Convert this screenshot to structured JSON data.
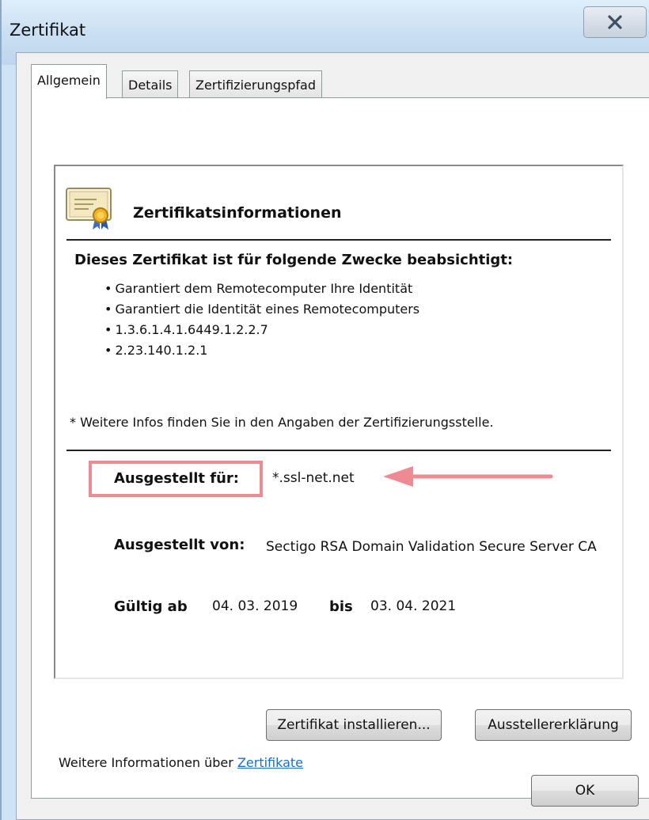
{
  "window": {
    "title": "Zertifikat"
  },
  "tabs": [
    {
      "label": "Allgemein"
    },
    {
      "label": "Details"
    },
    {
      "label": "Zertifizierungspfad"
    }
  ],
  "info": {
    "header": "Zertifikatsinformationen",
    "purpose_heading": "Dieses Zertifikat ist für folgende Zwecke beabsichtigt:",
    "purposes": [
      "Garantiert dem Remotecomputer Ihre Identität",
      "Garantiert die Identität eines Remotecomputers",
      "1.3.6.1.4.1.6449.1.2.2.7",
      "2.23.140.1.2.1"
    ],
    "note": "* Weitere Infos finden Sie in den Angaben der Zertifizierungsstelle.",
    "issued_to_label": "Ausgestellt für:",
    "issued_to_value": "*.ssl-net.net",
    "issued_by_label": "Ausgestellt von:",
    "issued_by_value": "Sectigo RSA Domain Validation Secure Server CA",
    "valid_from_label": "Gültig ab",
    "valid_from_value": "04. 03. 2019",
    "valid_to_label": "bis",
    "valid_to_value": "03. 04. 2021"
  },
  "buttons": {
    "install": "Zertifikat installieren...",
    "issuer_statement": "Ausstellererklärung",
    "ok": "OK"
  },
  "footer": {
    "text": "Weitere Informationen über ",
    "link": "Zertifikate"
  },
  "colors": {
    "highlight": "#f08a92",
    "link": "#1a6fc9"
  },
  "icons": {
    "close": "close-icon",
    "certificate": "certificate-icon",
    "arrow": "arrow-left-annotation"
  }
}
